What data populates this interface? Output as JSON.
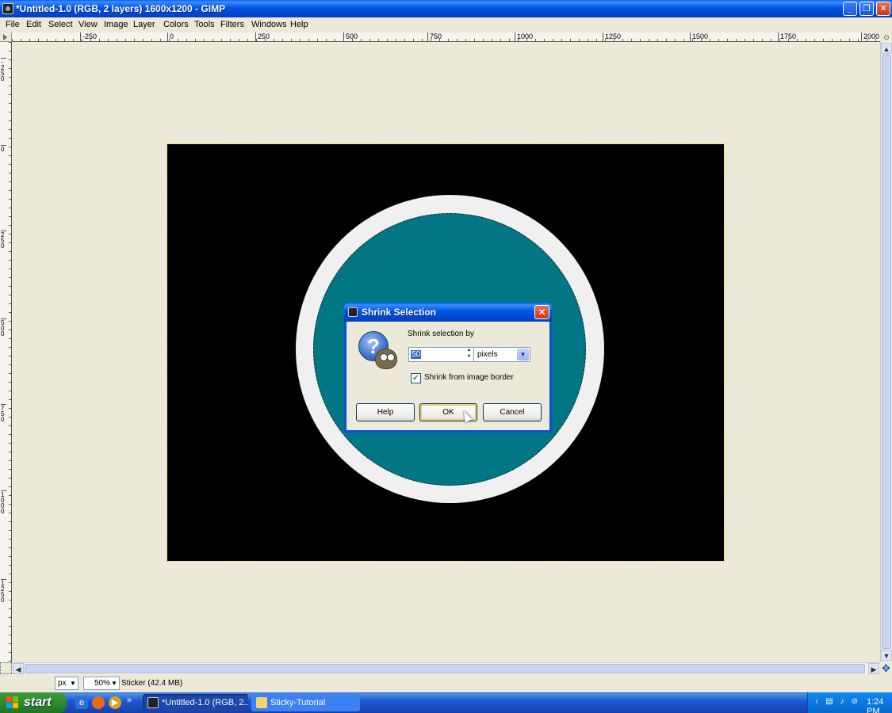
{
  "window": {
    "title": "*Untitled-1.0 (RGB, 2 layers) 1600x1200 - GIMP",
    "controls": {
      "minimize": "_",
      "maximize": "❐",
      "close": "✕"
    }
  },
  "menu": [
    "File",
    "Edit",
    "Select",
    "View",
    "Image",
    "Layer",
    "Colors",
    "Tools",
    "Filters",
    "Windows",
    "Help"
  ],
  "rulers": {
    "horizontal": [
      "-250",
      "0",
      "250",
      "500",
      "750",
      "1000",
      "1250",
      "1500",
      "1750",
      "2000"
    ],
    "vertical": [
      "-250",
      "0",
      "250",
      "500",
      "750",
      "1000",
      "1250"
    ]
  },
  "canvas": {
    "background": "#ece9d8",
    "image_color": "#000000",
    "ring_color": "#f0f0f0",
    "disc_color": "#017785"
  },
  "dialog": {
    "title": "Shrink Selection",
    "label": "Shrink selection by",
    "value": "50",
    "unit": "pixels",
    "checkbox_label": "Shrink from image border",
    "checkbox_checked": true,
    "buttons": {
      "help": "Help",
      "ok": "OK",
      "cancel": "Cancel"
    }
  },
  "status": {
    "unit": "px",
    "zoom": "50%",
    "info": "Sticker (42.4 MB)"
  },
  "taskbar": {
    "start": "start",
    "tasks": [
      "*Untitled-1.0 (RGB, 2...",
      "Sticky-Tutorial"
    ],
    "more": "»",
    "clock": "1:24 PM"
  }
}
